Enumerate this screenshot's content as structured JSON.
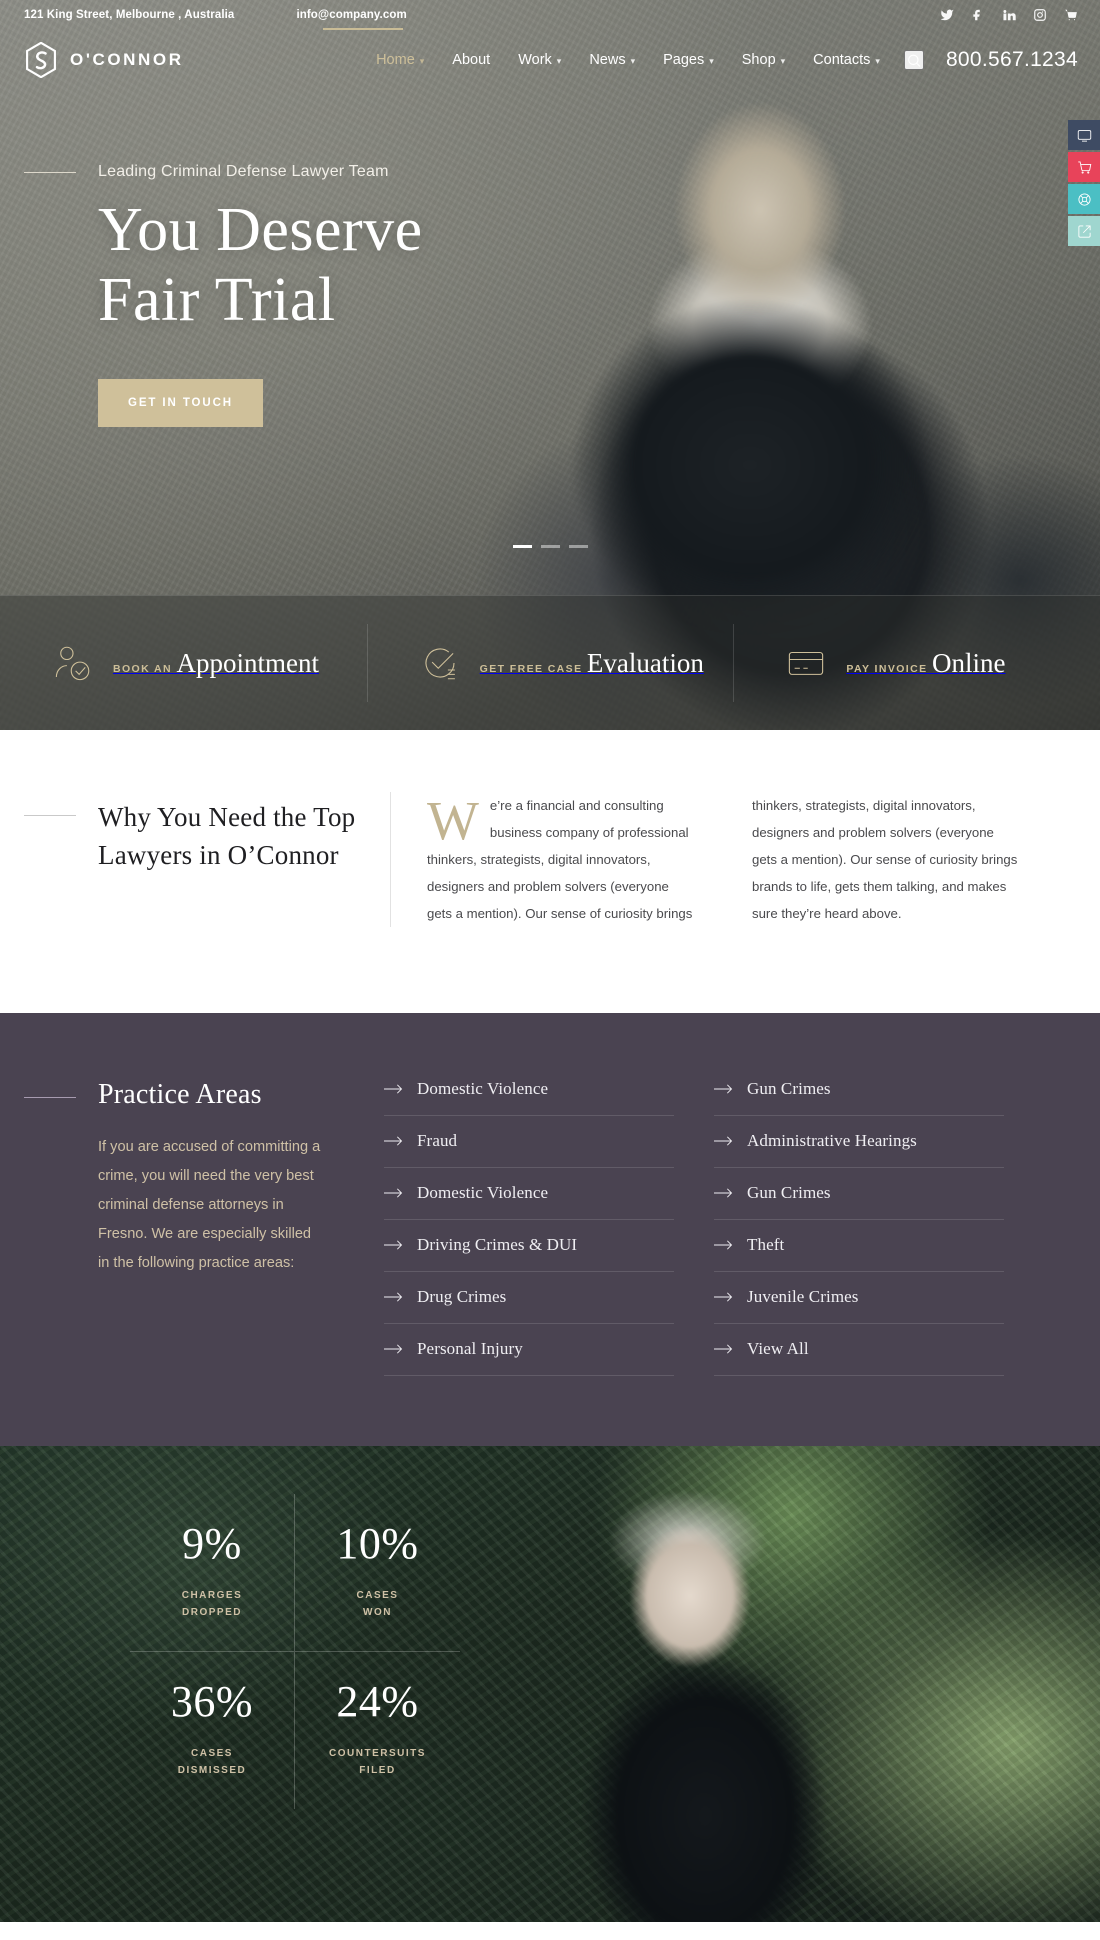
{
  "topbar": {
    "address": "121 King Street, Melbourne , Australia",
    "email": "info@company.com",
    "social": [
      {
        "name": "twitter-icon",
        "label": "Twitter"
      },
      {
        "name": "facebook-icon",
        "label": "Facebook"
      },
      {
        "name": "linkedin-icon",
        "label": "LinkedIn"
      },
      {
        "name": "instagram-icon",
        "label": "Instagram"
      },
      {
        "name": "cart-icon",
        "label": "Cart"
      }
    ]
  },
  "brand": {
    "name": "O'CONNOR",
    "logo_icon": "hexagon-swirl-logo"
  },
  "nav": {
    "items": [
      {
        "label": "Home",
        "has_dropdown": true,
        "active": true
      },
      {
        "label": "About",
        "has_dropdown": false,
        "active": false
      },
      {
        "label": "Work",
        "has_dropdown": true,
        "active": false
      },
      {
        "label": "News",
        "has_dropdown": true,
        "active": false
      },
      {
        "label": "Pages",
        "has_dropdown": true,
        "active": false
      },
      {
        "label": "Shop",
        "has_dropdown": true,
        "active": false
      },
      {
        "label": "Contacts",
        "has_dropdown": true,
        "active": false
      }
    ],
    "search_icon": "search-icon",
    "phone": "800.567.1234"
  },
  "hero": {
    "eyebrow": "Leading Criminal Defense Lawyer Team",
    "title_line1": "You Deserve",
    "title_line2": "Fair Trial",
    "cta": "GET IN TOUCH",
    "slides": [
      {
        "active": true
      },
      {
        "active": false
      },
      {
        "active": false
      }
    ]
  },
  "services": [
    {
      "small": "BOOK AN",
      "big": "Appointment",
      "icon": "user-check-icon"
    },
    {
      "small": "GET FREE CASE",
      "big": "Evaluation",
      "icon": "check-circle-list-icon"
    },
    {
      "small": "PAY INVOICE",
      "big": "Online",
      "icon": "credit-card-icon"
    }
  ],
  "why": {
    "heading": "Why You Need the Top Lawyers in O’Connor",
    "dropcap": "W",
    "paragraph1": "e’re a financial and consulting business company of professional thinkers, strategists, digital innovators, designers and problem solvers (everyone gets a mention). Our sense of curiosity brings",
    "paragraph2": "thinkers, strategists, digital innovators, designers and problem solvers (everyone gets a mention). Our sense of curiosity brings brands to life, gets them talking, and makes sure they’re heard above."
  },
  "practice": {
    "heading": "Practice Areas",
    "intro": "If you are accused of committing a crime, you will need the very best criminal defense attorneys in Fresno. We are especially skilled in the following practice areas:",
    "column_left": [
      "Domestic Violence",
      "Fraud",
      "Domestic Violence",
      "Driving Crimes & DUI",
      "Drug Crimes",
      "Personal Injury"
    ],
    "column_right": [
      "Gun Crimes",
      "Administrative Hearings",
      "Gun Crimes",
      "Theft",
      "Juvenile Crimes",
      "View All"
    ]
  },
  "chart_data": {
    "type": "bar",
    "title": "Case Outcome Statistics",
    "categories": [
      "CHARGES DROPPED",
      "CASES WON",
      "CASES DISMISSED",
      "COUNTERSUITS FILED"
    ],
    "values": [
      9,
      10,
      36,
      24
    ],
    "unit": "%",
    "xlabel": "",
    "ylabel": "",
    "ylim": [
      0,
      100
    ]
  },
  "stats": [
    {
      "num": "9%",
      "l1": "CHARGES",
      "l2": "DROPPED"
    },
    {
      "num": "10%",
      "l1": "CASES",
      "l2": "WON"
    },
    {
      "num": "36%",
      "l1": "CASES",
      "l2": "DISMISSED"
    },
    {
      "num": "24%",
      "l1": "COUNTERSUITS",
      "l2": "FILED"
    }
  ],
  "side_tools": [
    {
      "name": "preview-monitor-icon",
      "color": "#3e4b63"
    },
    {
      "name": "buy-cart-icon",
      "color": "#e8435a"
    },
    {
      "name": "support-icon",
      "color": "#4bbfc4"
    },
    {
      "name": "share-icon",
      "color": "#9fd6cf"
    }
  ]
}
